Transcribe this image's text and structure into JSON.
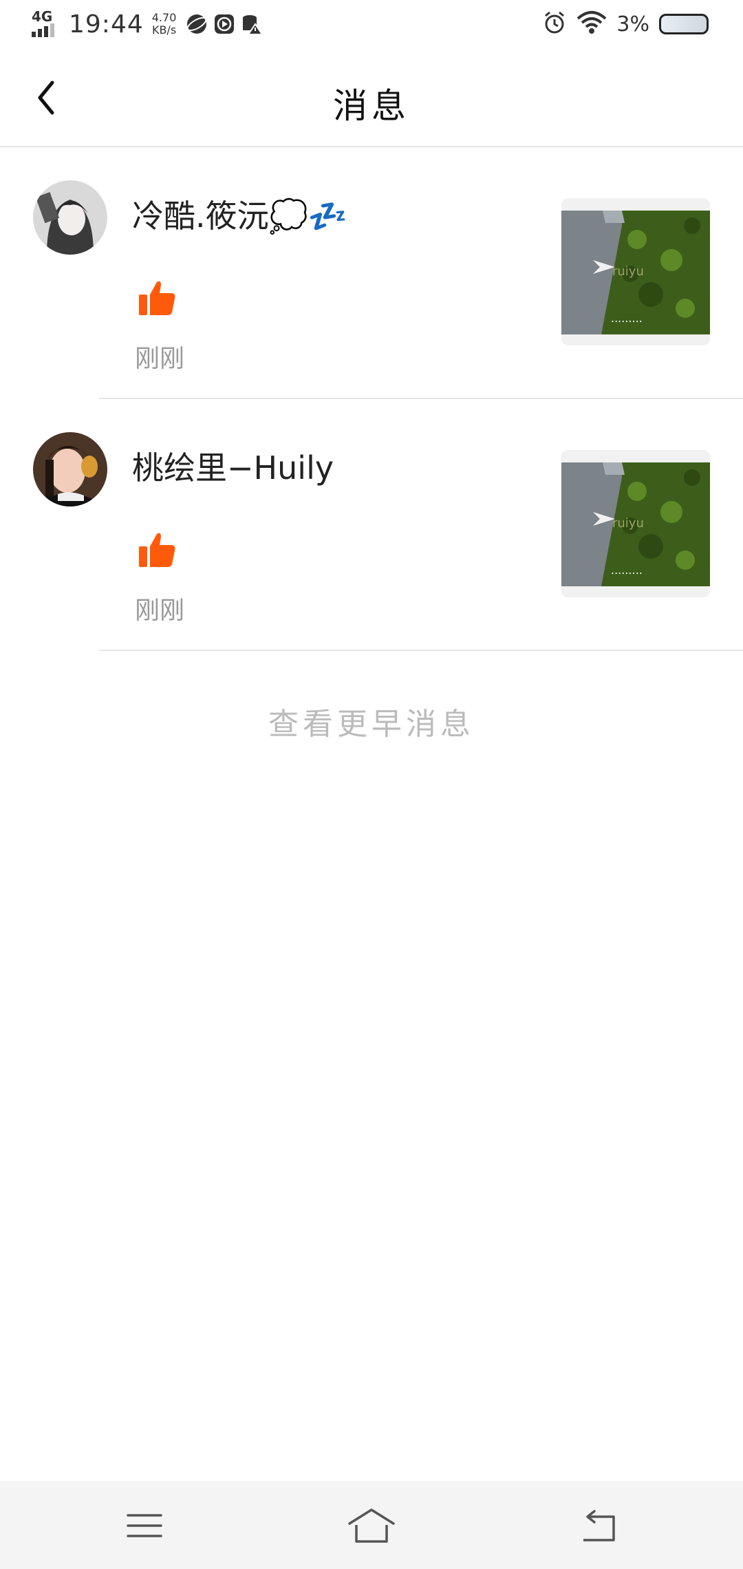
{
  "status_bar": {
    "network": "4G",
    "time": "19:44",
    "speed_value": "4.70",
    "speed_unit": "KB/s",
    "battery_text": "3%",
    "icons": [
      "browser-icon",
      "video-icon",
      "storage-warning-icon",
      "alarm-icon",
      "wifi-icon",
      "battery-icon"
    ]
  },
  "header": {
    "title": "消息"
  },
  "messages": [
    {
      "name": "冷酷.筱沅💭💤",
      "action_icon": "thumbs-up-icon",
      "time": "刚刚"
    },
    {
      "name": "桃绘里−Huily",
      "action_icon": "thumbs-up-icon",
      "time": "刚刚"
    }
  ],
  "footer": {
    "more_label": "查看更早消息"
  },
  "navbar": {
    "icons": [
      "menu-icon",
      "home-icon",
      "back-nav-icon"
    ]
  },
  "colors": {
    "accent": "#ff5a0a",
    "muted_text": "#999999",
    "divider": "#e6e6e6"
  }
}
